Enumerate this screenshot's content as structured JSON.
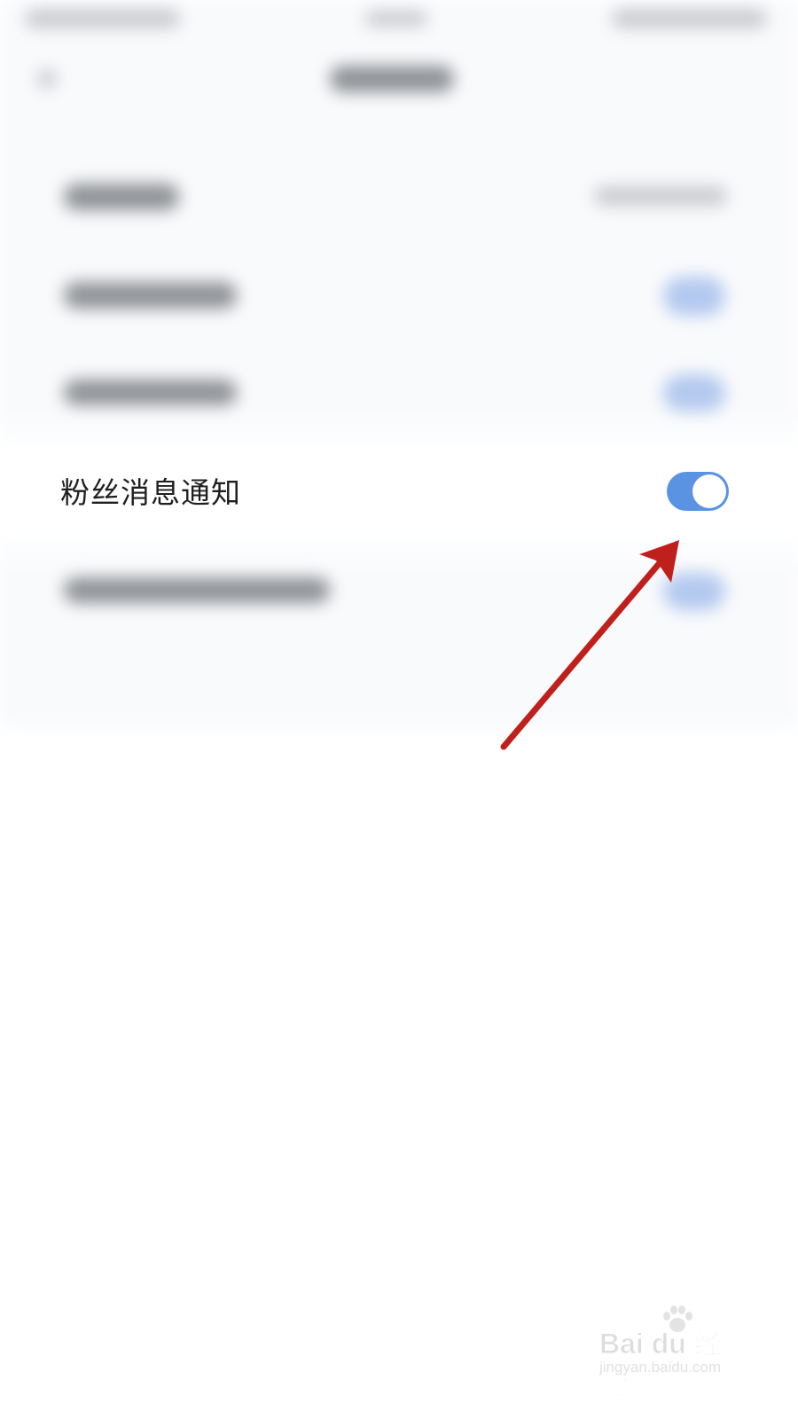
{
  "settings": {
    "rows": [
      {
        "label": "粉丝消息通知",
        "toggle": {
          "state": "on",
          "color": "#5b93e3"
        }
      }
    ]
  },
  "annotation": {
    "arrow_color": "#c0201c"
  },
  "watermark": {
    "logo": "Bai du 经验",
    "url": "jingyan.baidu.com"
  }
}
